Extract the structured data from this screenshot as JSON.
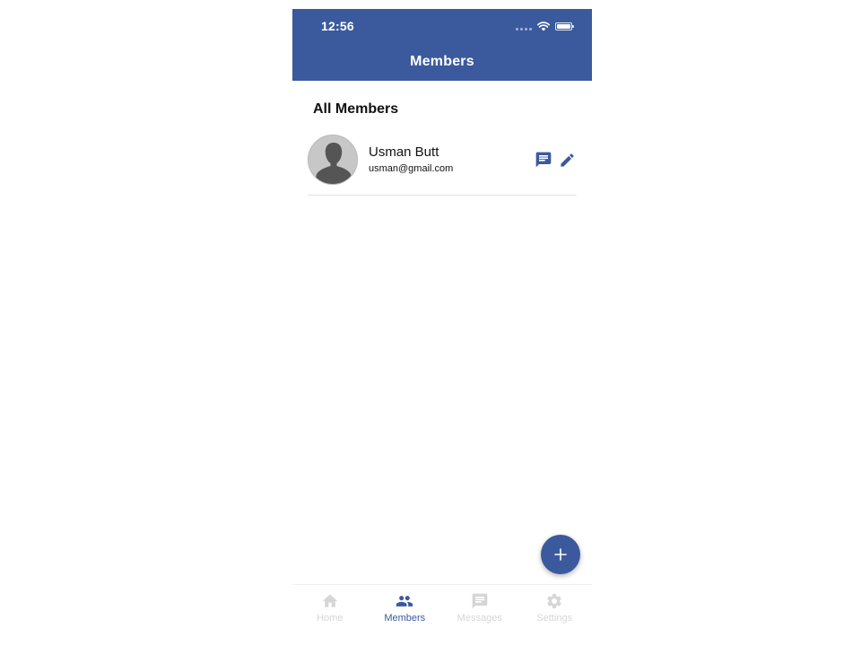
{
  "status_bar": {
    "time": "12:56"
  },
  "header": {
    "title": "Members"
  },
  "section": {
    "title": "All Members"
  },
  "members": [
    {
      "name": "Usman Butt",
      "email": "usman@gmail.com"
    }
  ],
  "fab": {
    "icon": "plus-icon"
  },
  "tab_bar": {
    "tabs": [
      {
        "label": "Home",
        "icon": "home-icon",
        "active": false
      },
      {
        "label": "Members",
        "icon": "members-icon",
        "active": true
      },
      {
        "label": "Messages",
        "icon": "message-icon",
        "active": false
      },
      {
        "label": "Settings",
        "icon": "gear-icon",
        "active": false
      }
    ]
  },
  "colors": {
    "primary": "#3b5a9d",
    "inactive_tab": "#d6d6d6",
    "divider": "#e2e2e2"
  }
}
